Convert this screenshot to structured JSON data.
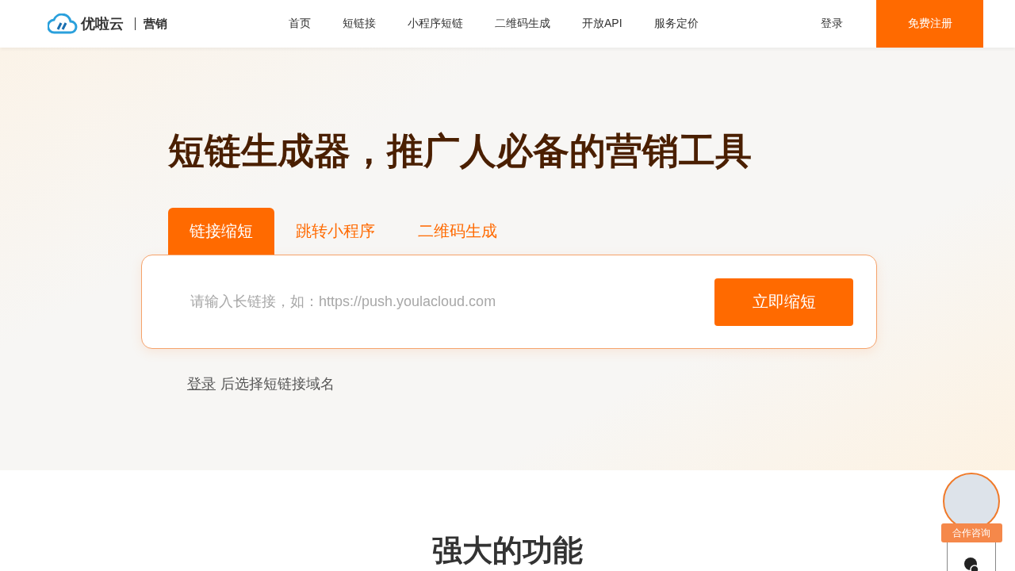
{
  "header": {
    "logo_name": "优啦云",
    "logo_tag": "营销",
    "nav": [
      {
        "label": "首页",
        "selected": false
      },
      {
        "label": "短链接",
        "selected": false
      },
      {
        "label": "小程序短链",
        "selected": false
      },
      {
        "label": "二维码生成",
        "selected": false
      },
      {
        "label": "开放API",
        "selected": false
      },
      {
        "label": "服务定价",
        "selected": false
      }
    ],
    "login": "登录",
    "register": "免费注册"
  },
  "hero": {
    "title": "短链生成器，推广人必备的营销工具",
    "tabs": [
      {
        "label": "链接缩短",
        "selected": true
      },
      {
        "label": "跳转小程序",
        "selected": false
      },
      {
        "label": "二维码生成",
        "selected": false
      }
    ],
    "input": {
      "placeholder": "请输入长链接，如：https://push.youlacloud.com"
    },
    "submit": "立即缩短",
    "hint_link": "登录",
    "hint_text": "后选择短链接域名"
  },
  "features": {
    "title": "强大的功能"
  },
  "consult": {
    "label": "合作咨询"
  }
}
